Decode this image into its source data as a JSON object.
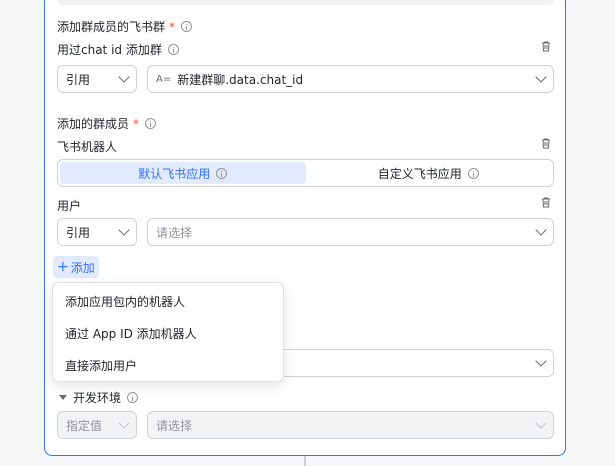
{
  "group_section": {
    "label": "添加群成员的飞书群",
    "required_mark": "*",
    "sub_label": "用过chat id 添加群",
    "mode_value": "引用",
    "var_icon": "A=",
    "value": "新建群聊.data.chat_id"
  },
  "members_section": {
    "label": "添加的群成员",
    "required_mark": "*",
    "bot_label": "飞书机器人",
    "bot_tabs": [
      "默认飞书应用",
      "自定义飞书应用"
    ],
    "user_label": "用户",
    "user_mode_value": "引用",
    "user_placeholder": "请选择"
  },
  "add_button": {
    "icon": "plus-icon",
    "label": "添加"
  },
  "add_menu": {
    "items": [
      "添加应用包内的机器人",
      "通过 App ID 添加机器人",
      "直接添加用户"
    ]
  },
  "dev_env": {
    "label": "开发环境",
    "mode_value": "指定值",
    "placeholder": "请选择"
  },
  "colors": {
    "accent": "#3370ff",
    "required": "#f54a45",
    "border": "#d0d3d6"
  }
}
